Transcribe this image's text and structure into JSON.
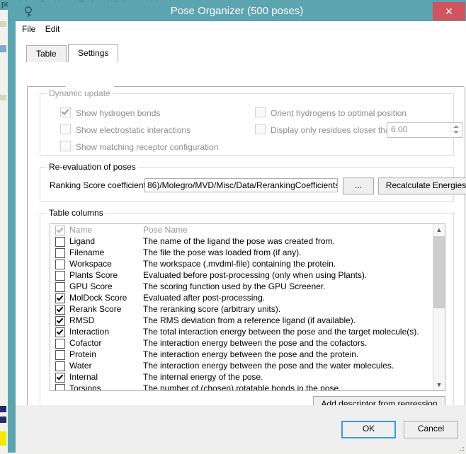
{
  "background_app": {
    "menu_items": [
      "paration",
      "Docking",
      "Tools",
      "Window",
      "Help"
    ]
  },
  "window": {
    "title": "Pose Organizer (500 poses)",
    "icon": "magnifier-key-icon",
    "close_label": "✕",
    "titlebar_color": "#5ba4b0",
    "close_color": "#d05360"
  },
  "menubar": {
    "items": [
      "File",
      "Edit"
    ]
  },
  "tabs": [
    {
      "label": "Table",
      "active": false
    },
    {
      "label": "Settings",
      "active": true
    }
  ],
  "dynamic_update": {
    "title": "Dynamic update",
    "enabled": false,
    "left_checkboxes": [
      {
        "label": "Show hydrogen bonds",
        "checked": true
      },
      {
        "label": "Show electrostatic interactions",
        "checked": false
      },
      {
        "label": "Show matching receptor configuration",
        "checked": false
      }
    ],
    "right_checkboxes": [
      {
        "label": "Orient hydrogens to optimal position",
        "checked": false
      },
      {
        "label": "Display only residues closer than (Å):",
        "checked": false
      }
    ],
    "distance_value": "6.00"
  },
  "reevaluation": {
    "title": "Re-evaluation of poses",
    "coefficients_label": "Ranking Score coefficients",
    "coefficients_path": "86)/Molegro/MVD/Misc/Data/RerankingCoefficients.txt",
    "browse_label": "...",
    "recalculate_label": "Recalculate Energies"
  },
  "table_columns": {
    "title": "Table columns",
    "rows": [
      {
        "checked": true,
        "disabled": true,
        "name": "Name",
        "desc": "Pose Name"
      },
      {
        "checked": false,
        "disabled": false,
        "name": "Ligand",
        "desc": "The name of the ligand the pose was created from."
      },
      {
        "checked": false,
        "disabled": false,
        "name": "Filename",
        "desc": "The file the pose was loaded from (if any)."
      },
      {
        "checked": false,
        "disabled": false,
        "name": "Workspace",
        "desc": "The workspace (.mvdml-file) containing the protein."
      },
      {
        "checked": false,
        "disabled": false,
        "name": "Plants Score",
        "desc": "Evaluated before post-processing (only when using Plants)."
      },
      {
        "checked": false,
        "disabled": false,
        "name": "GPU Score",
        "desc": "The scoring function used by the GPU Screener."
      },
      {
        "checked": true,
        "disabled": false,
        "name": "MolDock Score",
        "desc": "Evaluated after post-processing."
      },
      {
        "checked": true,
        "disabled": false,
        "name": "Rerank Score",
        "desc": "The reranking score (arbitrary units)."
      },
      {
        "checked": true,
        "disabled": false,
        "name": "RMSD",
        "desc": "The RMS deviation from a reference ligand (if available)."
      },
      {
        "checked": true,
        "disabled": false,
        "name": "Interaction",
        "desc": "The total interaction energy between the pose and the target molecule(s)."
      },
      {
        "checked": false,
        "disabled": false,
        "name": "Cofactor",
        "desc": "The interaction energy between the pose and the cofactors."
      },
      {
        "checked": false,
        "disabled": false,
        "name": "Protein",
        "desc": "The interaction energy between the pose and the protein."
      },
      {
        "checked": false,
        "disabled": false,
        "name": "Water",
        "desc": "The interaction energy between the pose and the water molecules."
      },
      {
        "checked": true,
        "disabled": false,
        "name": "Internal",
        "desc": "The internal energy of the pose."
      },
      {
        "checked": false,
        "disabled": false,
        "name": "Torsions",
        "desc": "The number of (chosen) rotatable bonds in the pose."
      }
    ],
    "add_descriptor_label": "Add descriptor from regression model..."
  },
  "footer": {
    "ok_label": "OK",
    "cancel_label": "Cancel"
  }
}
